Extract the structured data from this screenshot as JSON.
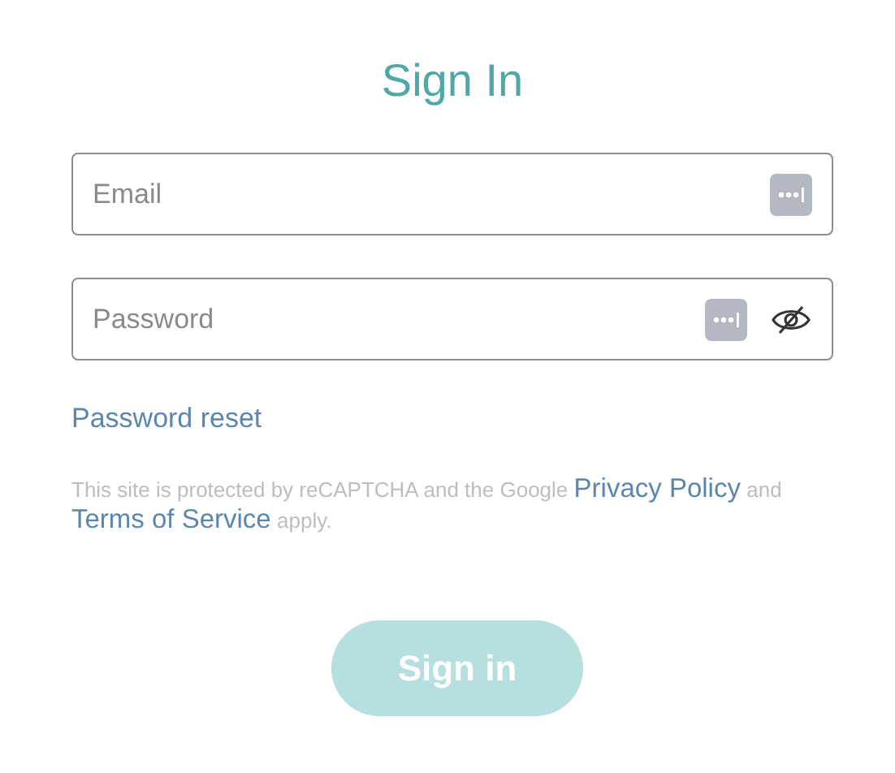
{
  "title": "Sign In",
  "fields": [
    {
      "placeholder": "Email",
      "kind": "email"
    },
    {
      "placeholder": "Password",
      "kind": "password",
      "reveal": false
    }
  ],
  "password_reset": "Password reset",
  "notice": [
    {
      "kind": "text",
      "text": "This site is protected by reCAPTCHA and the Google"
    },
    {
      "kind": "link",
      "text": "Privacy Policy"
    },
    {
      "kind": "text",
      "text": "and"
    },
    {
      "kind": "link",
      "text": "Terms of Service"
    },
    {
      "kind": "text",
      "text": "apply."
    }
  ],
  "submit": {
    "label": "Sign in",
    "disabled": true
  }
}
